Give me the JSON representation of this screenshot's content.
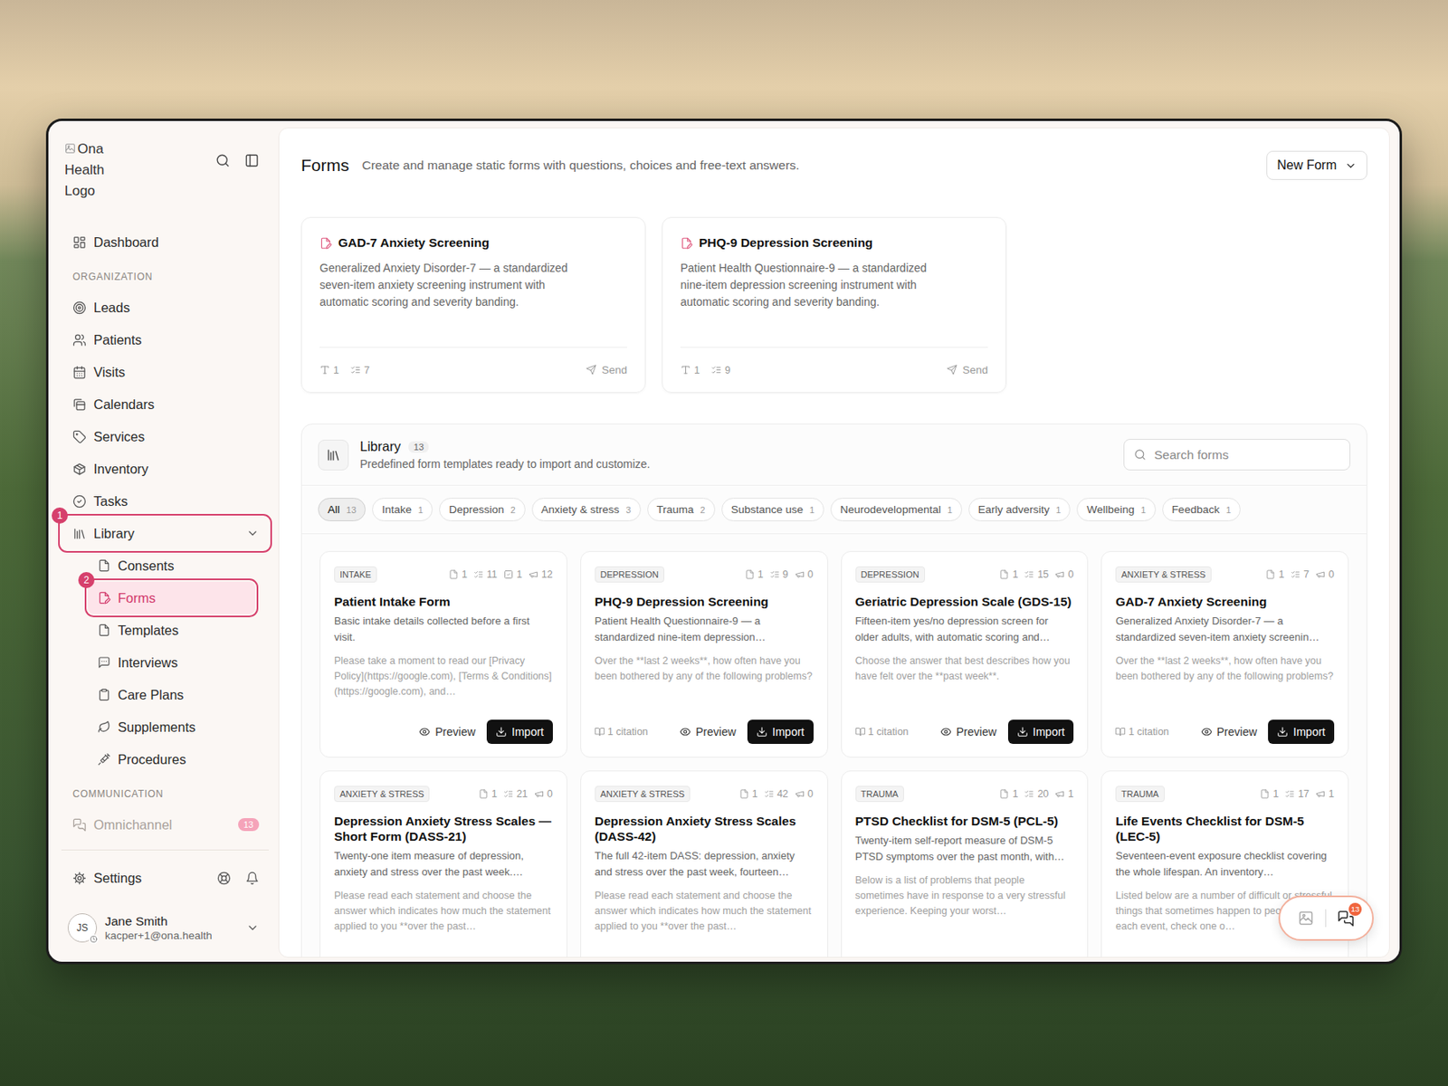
{
  "sidebar": {
    "logo_alt": "Ona Health Logo",
    "items": [
      {
        "label": "Dashboard",
        "selected": false,
        "dimmed": false
      }
    ],
    "sections": [
      {
        "label": "ORGANIZATION",
        "items": [
          {
            "label": "Leads",
            "selected": false,
            "dimmed": false
          },
          {
            "label": "Patients",
            "selected": false,
            "dimmed": false
          },
          {
            "label": "Visits",
            "selected": false,
            "dimmed": false
          },
          {
            "label": "Calendars",
            "selected": false,
            "dimmed": false
          },
          {
            "label": "Services",
            "selected": false,
            "dimmed": false
          },
          {
            "label": "Inventory",
            "selected": false,
            "dimmed": false
          },
          {
            "label": "Tasks",
            "selected": false,
            "dimmed": false
          },
          {
            "label": "Library",
            "selected": false,
            "dimmed": false,
            "expanded": true,
            "annotation": "1",
            "children": [
              {
                "label": "Consents",
                "selected": false
              },
              {
                "label": "Forms",
                "selected": true,
                "annotation": "2"
              },
              {
                "label": "Templates",
                "selected": false
              },
              {
                "label": "Interviews",
                "selected": false
              },
              {
                "label": "Care Plans",
                "selected": false
              },
              {
                "label": "Supplements",
                "selected": false
              },
              {
                "label": "Procedures",
                "selected": false
              }
            ]
          }
        ]
      },
      {
        "label": "COMMUNICATION",
        "items": [
          {
            "label": "Omnichannel",
            "selected": false,
            "dimmed": true,
            "badge": "13"
          }
        ]
      }
    ],
    "footer": {
      "settings": "Settings",
      "user": {
        "initials": "JS",
        "name": "Jane Smith",
        "email": "kacper+1@ona.health"
      }
    }
  },
  "header": {
    "title": "Forms",
    "subtitle": "Create and manage static forms with questions, choices and free-text answers.",
    "new_button": "New Form"
  },
  "forms": [
    {
      "title": "GAD-7 Anxiety Screening",
      "description": "Generalized Anxiety Disorder-7 — a standardized seven-item anxiety screening instrument with automatic scoring and severity banding.",
      "stats": [
        {
          "kind": "text",
          "value": "1"
        },
        {
          "kind": "questions",
          "value": "7"
        }
      ],
      "action": "Send"
    },
    {
      "title": "PHQ-9 Depression Screening",
      "description": "Patient Health Questionnaire-9 — a standardized nine-item depression screening instrument with automatic scoring and severity banding.",
      "stats": [
        {
          "kind": "text",
          "value": "1"
        },
        {
          "kind": "questions",
          "value": "9"
        }
      ],
      "action": "Send"
    }
  ],
  "library": {
    "title": "Library",
    "count": "13",
    "subtitle": "Predefined form templates ready to import and customize.",
    "search": {
      "placeholder": "Search forms"
    },
    "filters": [
      {
        "label": "All",
        "count": "13",
        "selected": true
      },
      {
        "label": "Intake",
        "count": "1",
        "selected": false
      },
      {
        "label": "Depression",
        "count": "2",
        "selected": false
      },
      {
        "label": "Anxiety & stress",
        "count": "3",
        "selected": false
      },
      {
        "label": "Trauma",
        "count": "2",
        "selected": false
      },
      {
        "label": "Substance use",
        "count": "1",
        "selected": false
      },
      {
        "label": "Neurodevelopmental",
        "count": "1",
        "selected": false
      },
      {
        "label": "Early adversity",
        "count": "1",
        "selected": false
      },
      {
        "label": "Wellbeing",
        "count": "1",
        "selected": false
      },
      {
        "label": "Feedback",
        "count": "1",
        "selected": false
      }
    ],
    "templates": [
      {
        "category": "INTAKE",
        "stats": [
          {
            "kind": "pages",
            "value": "1"
          },
          {
            "kind": "questions",
            "value": "11"
          },
          {
            "kind": "checks",
            "value": "1"
          },
          {
            "kind": "responses",
            "value": "12"
          }
        ],
        "title": "Patient Intake Form",
        "description": "Basic intake details collected before a first visit.",
        "preview": "Please take a moment to read our [Privacy Policy](https://google.com), [Terms & Conditions](https://google.com), and…",
        "citation": null,
        "actions": [
          {
            "label": "Preview",
            "kind": "preview"
          },
          {
            "label": "Import",
            "kind": "import"
          }
        ]
      },
      {
        "category": "DEPRESSION",
        "stats": [
          {
            "kind": "pages",
            "value": "1"
          },
          {
            "kind": "questions",
            "value": "9"
          },
          {
            "kind": "responses",
            "value": "0"
          }
        ],
        "title": "PHQ-9 Depression Screening",
        "description": "Patient Health Questionnaire-9 — a standardized nine-item depression…",
        "preview": "Over the **last 2 weeks**, how often have you been bothered by any of the following problems?",
        "citation": "1 citation",
        "actions": [
          {
            "label": "Preview",
            "kind": "preview"
          },
          {
            "label": "Import",
            "kind": "import"
          }
        ]
      },
      {
        "category": "DEPRESSION",
        "stats": [
          {
            "kind": "pages",
            "value": "1"
          },
          {
            "kind": "questions",
            "value": "15"
          },
          {
            "kind": "responses",
            "value": "0"
          }
        ],
        "title": "Geriatric Depression Scale (GDS-15)",
        "description": "Fifteen-item yes/no depression screen for older adults, with automatic scoring and…",
        "preview": "Choose the answer that best describes how you have felt over the **past week**.",
        "citation": "1 citation",
        "actions": [
          {
            "label": "Preview",
            "kind": "preview"
          },
          {
            "label": "Import",
            "kind": "import"
          }
        ]
      },
      {
        "category": "ANXIETY & STRESS",
        "stats": [
          {
            "kind": "pages",
            "value": "1"
          },
          {
            "kind": "questions",
            "value": "7"
          },
          {
            "kind": "responses",
            "value": "0"
          }
        ],
        "title": "GAD-7 Anxiety Screening",
        "description": "Generalized Anxiety Disorder-7 — a standardized seven-item anxiety screenin…",
        "preview": "Over the **last 2 weeks**, how often have you been bothered by any of the following problems?",
        "citation": "1 citation",
        "actions": [
          {
            "label": "Preview",
            "kind": "preview"
          },
          {
            "label": "Import",
            "kind": "import"
          }
        ]
      },
      {
        "category": "ANXIETY & STRESS",
        "stats": [
          {
            "kind": "pages",
            "value": "1"
          },
          {
            "kind": "questions",
            "value": "21"
          },
          {
            "kind": "responses",
            "value": "0"
          }
        ],
        "title": "Depression Anxiety Stress Scales — Short Form (DASS-21)",
        "description": "Twenty-one item measure of depression, anxiety and stress over the past week.…",
        "preview": "Please read each statement and choose the answer which indicates how much the statement applied to you **over the past…",
        "citation": null,
        "actions": []
      },
      {
        "category": "ANXIETY & STRESS",
        "stats": [
          {
            "kind": "pages",
            "value": "1"
          },
          {
            "kind": "questions",
            "value": "42"
          },
          {
            "kind": "responses",
            "value": "0"
          }
        ],
        "title": "Depression Anxiety Stress Scales (DASS-42)",
        "description": "The full 42-item DASS: depression, anxiety and stress over the past week, fourteen…",
        "preview": "Please read each statement and choose the answer which indicates how much the statement applied to you **over the past…",
        "citation": null,
        "actions": []
      },
      {
        "category": "TRAUMA",
        "stats": [
          {
            "kind": "pages",
            "value": "1"
          },
          {
            "kind": "questions",
            "value": "20"
          },
          {
            "kind": "responses",
            "value": "1"
          }
        ],
        "title": "PTSD Checklist for DSM-5 (PCL-5)",
        "description": "Twenty-item self-report measure of DSM-5 PTSD symptoms over the past month, with…",
        "preview": "Below is a list of problems that people sometimes have in response to a very stressful experience. Keeping your worst…",
        "citation": null,
        "actions": []
      },
      {
        "category": "TRAUMA",
        "stats": [
          {
            "kind": "pages",
            "value": "1"
          },
          {
            "kind": "questions",
            "value": "17"
          },
          {
            "kind": "responses",
            "value": "1"
          }
        ],
        "title": "Life Events Checklist for DSM-5 (LEC-5)",
        "description": "Seventeen-event exposure checklist covering the whole lifespan. An inventory…",
        "preview": "Listed below are a number of difficult or stressful things that sometimes happen to people. For each event, check one o…",
        "citation": null,
        "actions": []
      }
    ]
  },
  "chat_widget": {
    "badge": "13"
  }
}
